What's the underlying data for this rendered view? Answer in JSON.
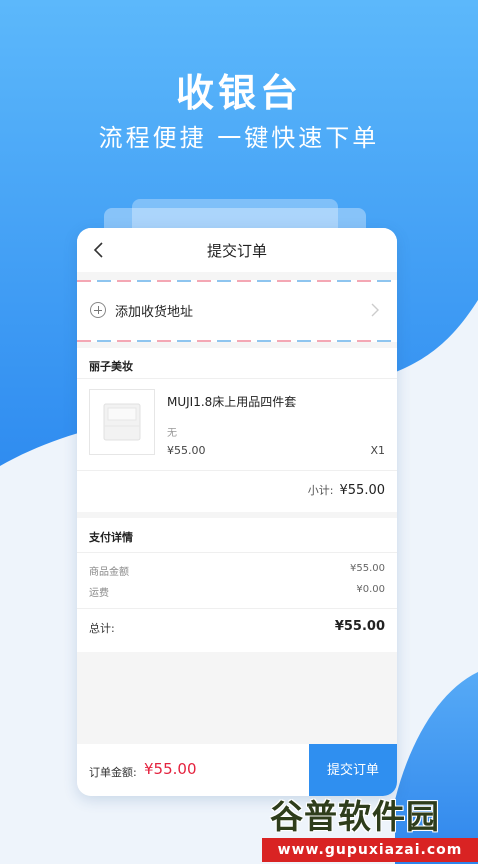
{
  "hero": {
    "title": "收银台",
    "subtitle": "流程便捷 一键快速下单"
  },
  "nav": {
    "back_icon": "chevron-left-icon",
    "title": "提交订单"
  },
  "address": {
    "add_label": "添加收货地址"
  },
  "shop": {
    "name": "丽子美妆",
    "product": {
      "name": "MUJI1.8床上用品四件套",
      "spec": "无",
      "price": "¥55.00",
      "qty": "X1"
    },
    "subtotal_label": "小计:",
    "subtotal_value": "¥55.00"
  },
  "payment": {
    "title": "支付详情",
    "rows": [
      {
        "label": "商品金额",
        "value": "¥55.00"
      },
      {
        "label": "运费",
        "value": "¥0.00"
      }
    ],
    "total_label": "总计:",
    "total_value": "¥55.00"
  },
  "footer": {
    "amount_label": "订单金额:",
    "amount_value": "¥55.00",
    "submit_label": "提交订单"
  },
  "watermark": {
    "brand": "谷普软件园",
    "url": "www.gupuxiazai.com"
  },
  "colors": {
    "primary": "#2f8ff0",
    "price_red": "#e4233f",
    "bg_blue": "#3e9af0"
  }
}
